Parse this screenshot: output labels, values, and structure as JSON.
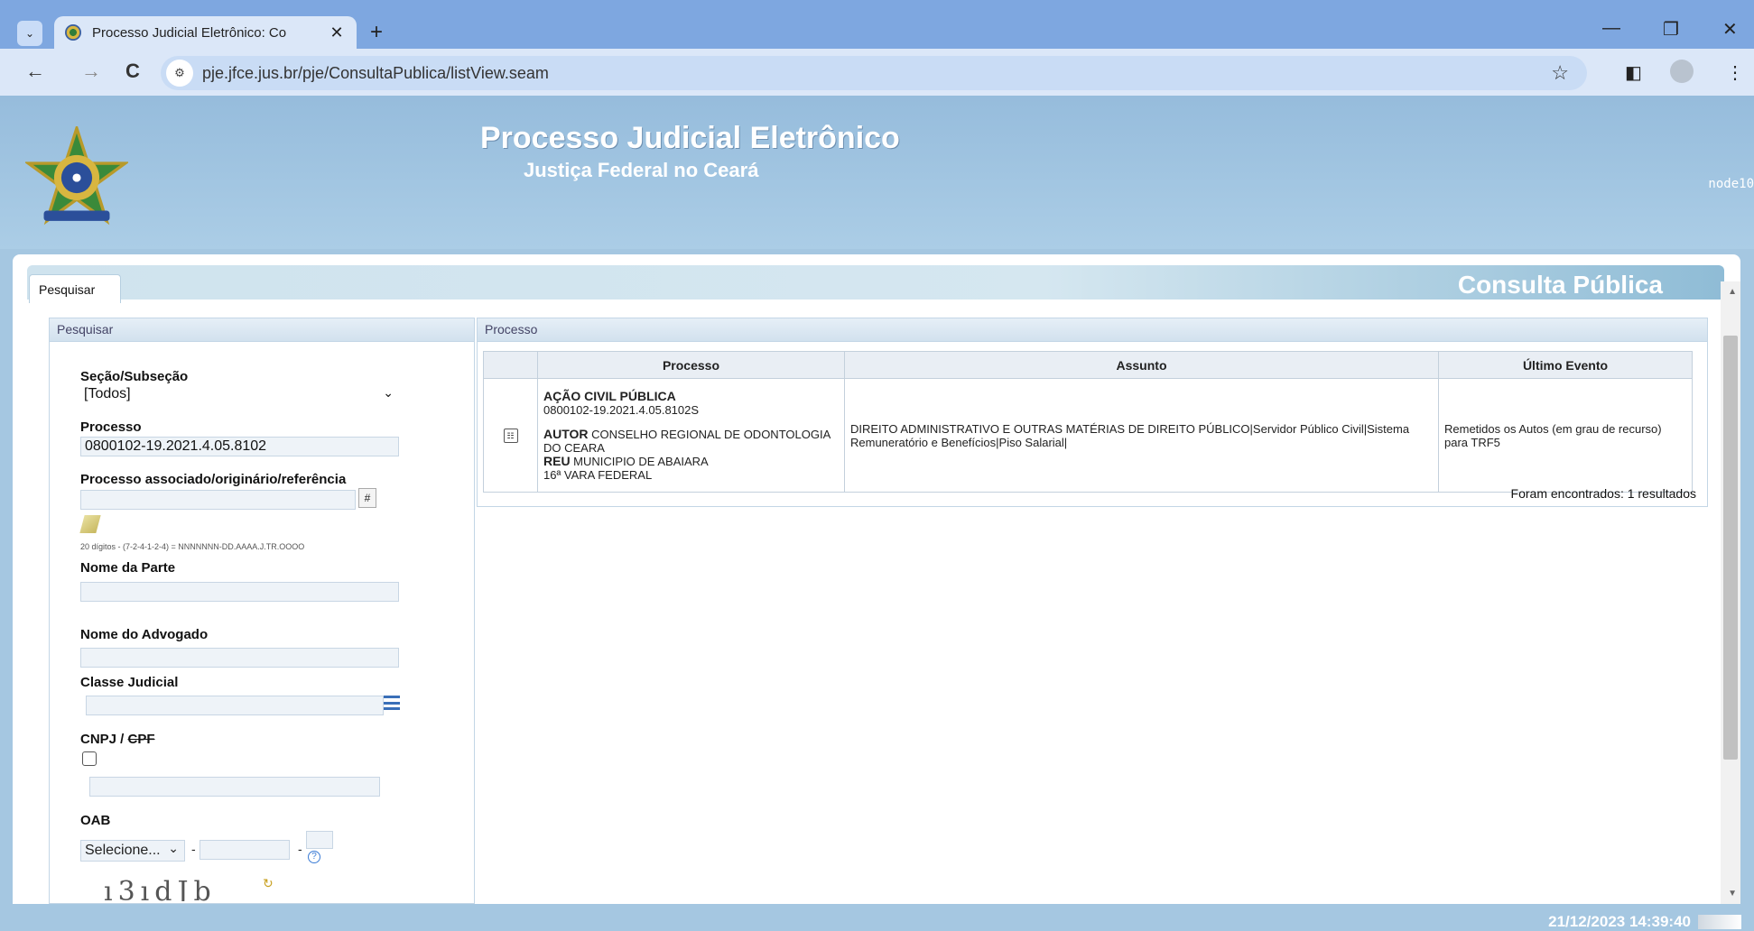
{
  "browser": {
    "tab_title": "Processo Judicial Eletrônico: Co",
    "tab_close": "✕",
    "new_tab": "+",
    "url": "pje.jfce.jus.br/pje/ConsultaPublica/listView.seam",
    "controls": {
      "back": "←",
      "forward": "→",
      "reload": "C",
      "star": "☆",
      "sidepanel": "◧",
      "menu": "⋮",
      "minimize": "—",
      "restore": "❐",
      "close": "✕",
      "tabmenu": "⌄",
      "site_info": "⚙"
    }
  },
  "header": {
    "title": "Processo Judicial Eletrônico",
    "subtitle": "Justiça Federal no Ceará",
    "node": "node10"
  },
  "panel": {
    "tab_label": "Pesquisar",
    "title": "Consulta Pública"
  },
  "search": {
    "section_title": "Pesquisar",
    "secao_label": "Seção/Subseção",
    "secao_value": "[Todos]",
    "processo_label": "Processo",
    "processo_value": "0800102-19.2021.4.05.8102",
    "associado_label": "Processo associado/originário/referência",
    "associado_value": "",
    "hint": "20 dígitos - (7-2-4-1-2-4) = NNNNNNN-DD.AAAA.J.TR.OOOO",
    "parte_label": "Nome da Parte",
    "advogado_label": "Nome do Advogado",
    "classe_label": "Classe Judicial",
    "cnpj_label": "CNPJ / ",
    "cpf_label": "CPF",
    "oab_label": "OAB",
    "oab_select": "Selecione...",
    "dash": "-",
    "help": "?",
    "captcha_text": "ı3ıdJb"
  },
  "results": {
    "section_title": "Processo",
    "columns": [
      "Processo",
      "Assunto",
      "Último Evento"
    ],
    "rows": [
      {
        "classe": "AÇÃO CIVIL PÚBLICA",
        "numero": "0800102-19.2021.4.05.8102S",
        "autor_prefix": "AUTOR",
        "autor": " CONSELHO REGIONAL DE ODONTOLOGIA DO CEARA",
        "reu_prefix": "REU",
        "reu": " MUNICIPIO DE ABAIARA",
        "vara": "16ª VARA FEDERAL",
        "assunto": "DIREITO ADMINISTRATIVO E OUTRAS MATÉRIAS DE DIREITO PÚBLICO|Servidor Público Civil|Sistema Remuneratório e Benefícios|Piso Salarial|",
        "ultimo_evento": "Remetidos os Autos (em grau de recurso) para TRF5"
      }
    ],
    "count_text": "Foram encontrados: 1 resultados"
  },
  "status": {
    "datetime": "21/12/2023 14:39:40"
  }
}
